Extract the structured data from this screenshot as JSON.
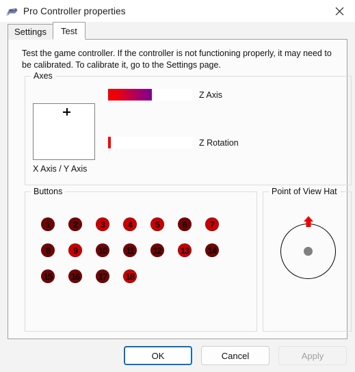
{
  "window": {
    "title": "Pro Controller properties",
    "icon": "gamepad-icon",
    "close_label": "✕"
  },
  "tabs": [
    {
      "label": "Settings",
      "active": false
    },
    {
      "label": "Test",
      "active": true
    }
  ],
  "description": "Test the game controller.  If the controller is not functioning properly, it may need to be calibrated.  To calibrate it, go to the Settings page.",
  "axes": {
    "group_title": "Axes",
    "xy_label": "X Axis / Y Axis",
    "crosshair": "crosshair-icon",
    "bars": [
      {
        "label": "Z Axis",
        "fill_percent": 52
      },
      {
        "label": "Z Rotation",
        "fill_percent": 3
      }
    ]
  },
  "buttons_group": {
    "group_title": "Buttons",
    "buttons": [
      {
        "number": "1",
        "state": "dark"
      },
      {
        "number": "2",
        "state": "dark"
      },
      {
        "number": "3",
        "state": "bright"
      },
      {
        "number": "4",
        "state": "bright"
      },
      {
        "number": "5",
        "state": "bright"
      },
      {
        "number": "6",
        "state": "dark"
      },
      {
        "number": "7",
        "state": "bright"
      },
      {
        "number": "8",
        "state": "dark"
      },
      {
        "number": "9",
        "state": "bright"
      },
      {
        "number": "10",
        "state": "dark"
      },
      {
        "number": "11",
        "state": "dark"
      },
      {
        "number": "12",
        "state": "dark"
      },
      {
        "number": "13",
        "state": "bright"
      },
      {
        "number": "14",
        "state": "dark"
      },
      {
        "number": "15",
        "state": "dark"
      },
      {
        "number": "16",
        "state": "dark"
      },
      {
        "number": "17",
        "state": "dark"
      },
      {
        "number": "18",
        "state": "bright"
      }
    ]
  },
  "pov": {
    "group_title": "Point of View Hat",
    "direction": "up",
    "arrow_icon": "arrow-up-icon",
    "center_icon": "hat-center-dot"
  },
  "footer": {
    "ok_label": "OK",
    "cancel_label": "Cancel",
    "apply_label": "Apply"
  },
  "colors": {
    "accent": "#0f6cbd",
    "axis_fill_start": "#f50000",
    "axis_fill_end": "#7d0090",
    "button_active": "#cc0000",
    "button_idle": "#6e0505"
  }
}
